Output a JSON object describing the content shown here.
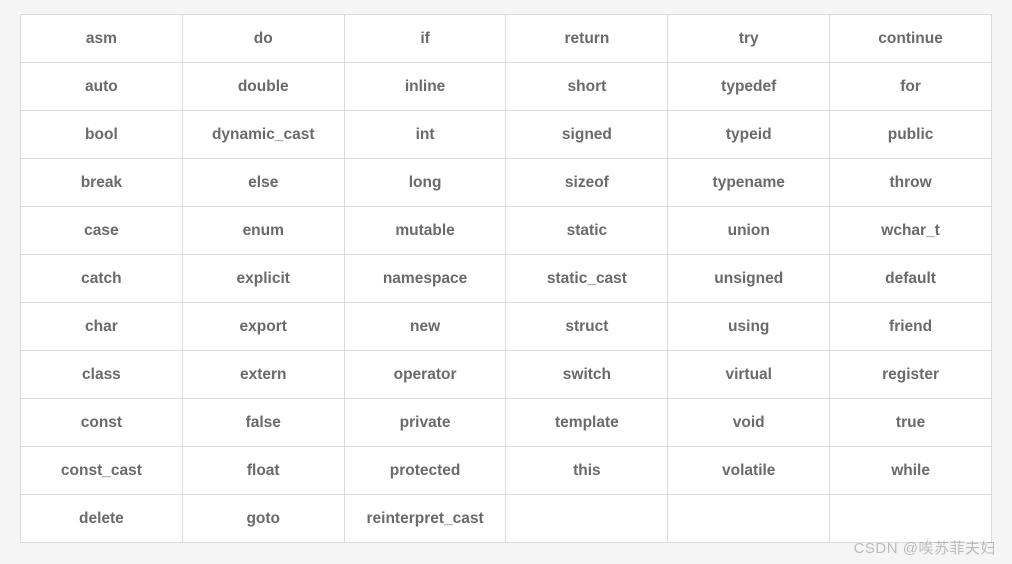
{
  "chart_data": {
    "type": "table",
    "title": "",
    "columns": 6,
    "rows": [
      [
        "asm",
        "do",
        "if",
        "return",
        "try",
        "continue"
      ],
      [
        "auto",
        "double",
        "inline",
        "short",
        "typedef",
        "for"
      ],
      [
        "bool",
        "dynamic_cast",
        "int",
        "signed",
        "typeid",
        "public"
      ],
      [
        "break",
        "else",
        "long",
        "sizeof",
        "typename",
        "throw"
      ],
      [
        "case",
        "enum",
        "mutable",
        "static",
        "union",
        "wchar_t"
      ],
      [
        "catch",
        "explicit",
        "namespace",
        "static_cast",
        "unsigned",
        "default"
      ],
      [
        "char",
        "export",
        "new",
        "struct",
        "using",
        "friend"
      ],
      [
        "class",
        "extern",
        "operator",
        "switch",
        "virtual",
        "register"
      ],
      [
        "const",
        "false",
        "private",
        "template",
        "void",
        "true"
      ],
      [
        "const_cast",
        "float",
        "protected",
        "this",
        "volatile",
        "while"
      ],
      [
        "delete",
        "goto",
        "reinterpret_cast",
        "",
        "",
        ""
      ]
    ]
  },
  "watermark": "CSDN @唉苏菲夫妇"
}
